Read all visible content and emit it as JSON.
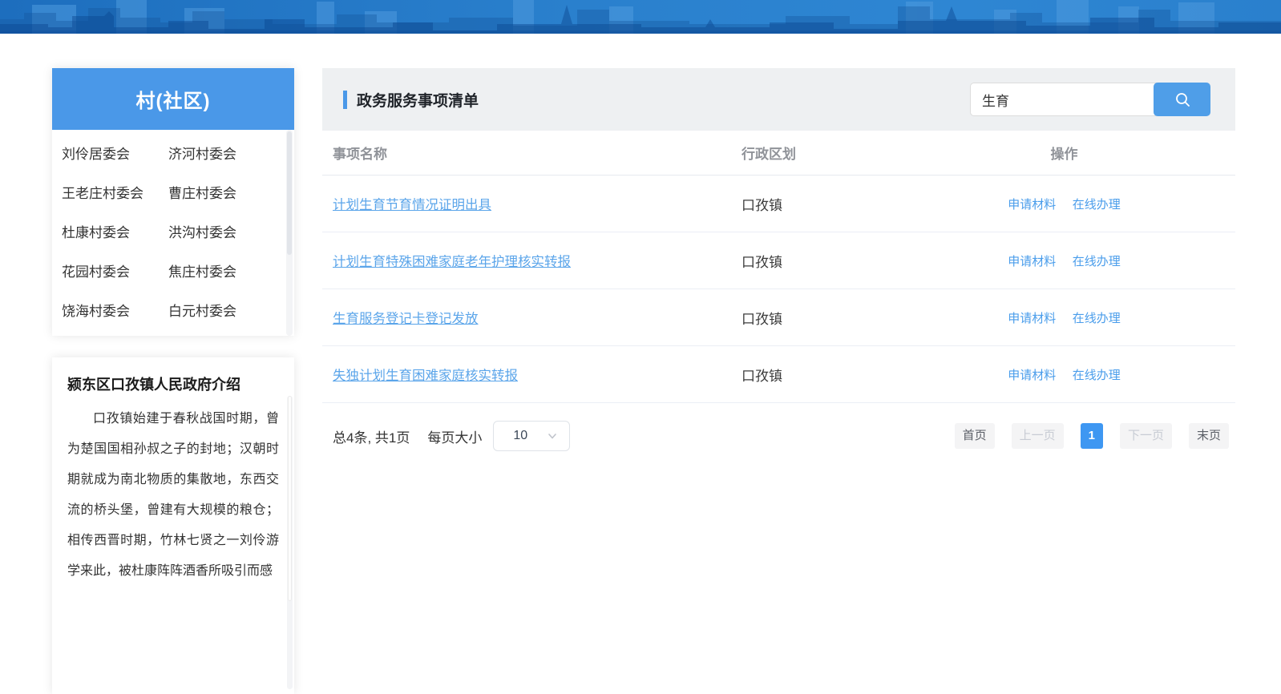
{
  "colors": {
    "primary_blue": "#4a98e8",
    "search_button_blue": "#4f9ee8",
    "link_blue": "#5ba5ea",
    "action_link_blue": "#4a9deb",
    "pager_active_blue": "#3e97f2",
    "banner_blue": "#2a80cd"
  },
  "sidebar": {
    "header": "村(社区)",
    "villages": [
      "刘伶居委会",
      "济河村委会",
      "王老庄村委会",
      "曹庄村委会",
      "杜康村委会",
      "洪沟村委会",
      "花园村委会",
      "焦庄村委会",
      "饶海村委会",
      "白元村委会"
    ],
    "intro": {
      "title": "颍东区口孜镇人民政府介绍",
      "text": "口孜镇始建于春秋战国时期，曾为楚国国相孙叔之子的封地；汉朝时期就成为南北物质的集散地，东西交流的桥头堡，曾建有大规模的粮仓；相传西晋时期，竹林七贤之一刘伶游学来此，被杜康阵阵酒香所吸引而感"
    }
  },
  "main": {
    "title": "政务服务事项清单",
    "search": {
      "value": "生育",
      "icon": "search-icon"
    },
    "table": {
      "columns": [
        "事项名称",
        "行政区划",
        "操作"
      ],
      "rows": [
        {
          "name": "计划生育节育情况证明出具",
          "region": "口孜镇",
          "actions": [
            "申请材料",
            "在线办理"
          ]
        },
        {
          "name": "计划生育特殊困难家庭老年护理核实转报",
          "region": "口孜镇",
          "actions": [
            "申请材料",
            "在线办理"
          ]
        },
        {
          "name": "生育服务登记卡登记发放",
          "region": "口孜镇",
          "actions": [
            "申请材料",
            "在线办理"
          ]
        },
        {
          "name": "失独计划生育困难家庭核实转报",
          "region": "口孜镇",
          "actions": [
            "申请材料",
            "在线办理"
          ]
        }
      ]
    },
    "pagination": {
      "summary": "总4条, 共1页",
      "page_size_label": "每页大小",
      "page_size": "10",
      "buttons": [
        {
          "label": "首页",
          "state": "normal"
        },
        {
          "label": "上一页",
          "state": "disabled"
        },
        {
          "label": "1",
          "state": "active"
        },
        {
          "label": "下一页",
          "state": "disabled"
        },
        {
          "label": "末页",
          "state": "normal"
        }
      ]
    }
  }
}
